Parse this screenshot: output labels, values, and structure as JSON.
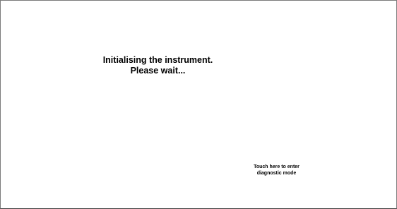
{
  "screen": {
    "message_line1": "Initialising the instrument.",
    "message_line2": "Please wait...",
    "diagnostic_line1": "Touch here to enter",
    "diagnostic_line2": "diagnostic mode"
  },
  "colors": {
    "background": "#ffffff",
    "text": "#000000",
    "frame": "#7a7a7a"
  }
}
